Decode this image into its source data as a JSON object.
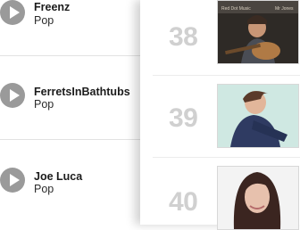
{
  "left_list": [
    {
      "artist": "Freenz",
      "genre": "Pop"
    },
    {
      "artist": "FerretsInBathtubs",
      "genre": "Pop"
    },
    {
      "artist": "Joe Luca",
      "genre": "Pop"
    }
  ],
  "right_list": [
    {
      "rank": "38",
      "thumb_caption_left": "Red Dot Music",
      "thumb_caption_right": "Mr Jones"
    },
    {
      "rank": "39"
    },
    {
      "rank": "40"
    }
  ]
}
